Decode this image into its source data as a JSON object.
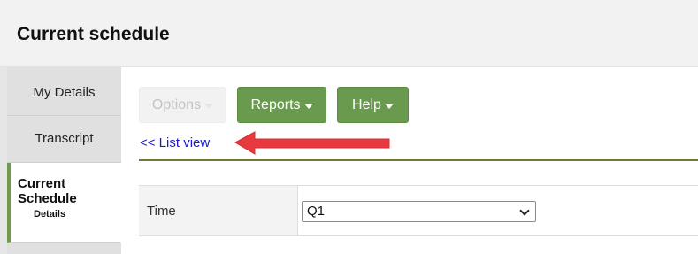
{
  "header": {
    "title": "Current schedule"
  },
  "sidebar": {
    "items": [
      {
        "label": "My Details"
      },
      {
        "label": "Transcript"
      },
      {
        "label": "Current Schedule",
        "sublabel": "Details"
      }
    ]
  },
  "toolbar": {
    "options_label": "Options",
    "reports_label": "Reports",
    "help_label": "Help"
  },
  "nav": {
    "list_view_label": "<< List view"
  },
  "form": {
    "time_label": "Time",
    "time_value": "Q1"
  },
  "colors": {
    "accent_green": "#6a9a4e",
    "link_blue": "#1a1ad6",
    "arrow_red": "#e8393f"
  }
}
